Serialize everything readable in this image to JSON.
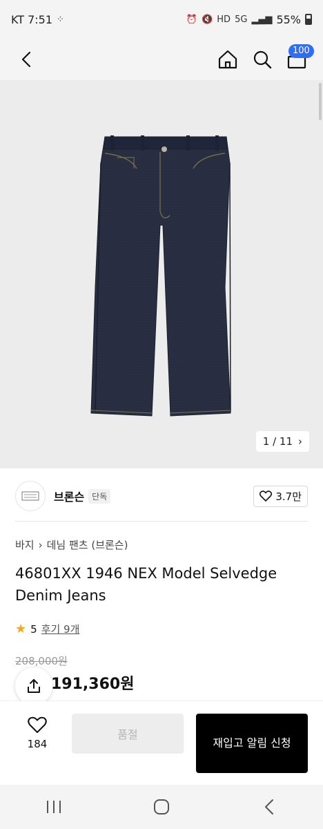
{
  "status_bar": {
    "carrier_time": "KT 7:51",
    "battery": "55%",
    "icons": [
      "alarm-icon",
      "mute-icon",
      "hd-icon",
      "5g-icon",
      "signal-icon",
      "battery-icon"
    ]
  },
  "header": {
    "cart_badge": "100",
    "icons": [
      "back-icon",
      "home-icon",
      "search-icon",
      "cart-icon"
    ]
  },
  "gallery": {
    "current": "1",
    "total": "11",
    "counter_text": "1 / 11"
  },
  "brand": {
    "name": "브론슨",
    "tag": "단독",
    "likes": "3.7만"
  },
  "breadcrumb": {
    "level1": "바지",
    "level2": "데님 팬츠 (브론슨)"
  },
  "product": {
    "title": "46801XX 1946 NEX Model Selvedge Denim Jeans",
    "rating": "5",
    "review_text": "후기 9개",
    "original_price": "208,000원",
    "sale_price": "191,360원"
  },
  "actions": {
    "wish_count": "184",
    "soldout_label": "품절",
    "restock_label": "재입고 알림 신청"
  },
  "colors": {
    "accent": "#2f6df6",
    "star": "#f5a623",
    "denim": "#262c3f"
  }
}
